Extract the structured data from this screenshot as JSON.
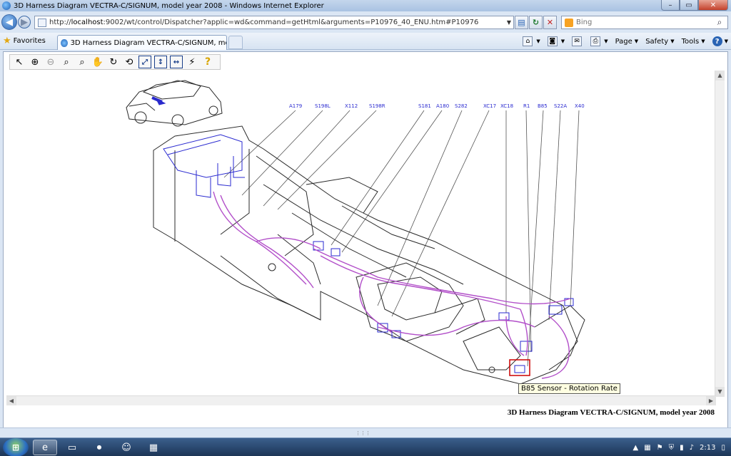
{
  "window": {
    "title": "3D Harness Diagram VECTRA-C/SIGNUM, model year 2008 - Windows Internet Explorer",
    "minimize": "–",
    "maximize": "▭",
    "close": "✕"
  },
  "address": {
    "url_prefix": "http://",
    "url_host": "localhost",
    "url_rest": ":9002/wt/control/Dispatcher?applic=wd&command=getHtml&arguments=P10976_40_ENU.htm#P10976"
  },
  "search": {
    "placeholder": "Bing"
  },
  "favorites": {
    "label": "Favorites"
  },
  "tab": {
    "label": "3D Harness Diagram VECTRA-C/SIGNUM, model ..."
  },
  "commands": [
    {
      "label": "Page"
    },
    {
      "label": "Safety"
    },
    {
      "label": "Tools"
    }
  ],
  "connector_labels": [
    "A179",
    "S198L",
    "X112",
    "S198R",
    "S181",
    "A180",
    "S282",
    "XC17",
    "XC18",
    "R1",
    "B85",
    "S22A",
    "X40"
  ],
  "caption": "3D Harness Diagram VECTRA-C/SIGNUM, model year 2008",
  "tooltip": "B85 Sensor - Rotation Rate",
  "clock": "2:13",
  "colors": {
    "harness": "#b24fc9",
    "connector": "#2a2ad0",
    "outline": "#2a2a2a",
    "highlight": "#cc0000"
  }
}
